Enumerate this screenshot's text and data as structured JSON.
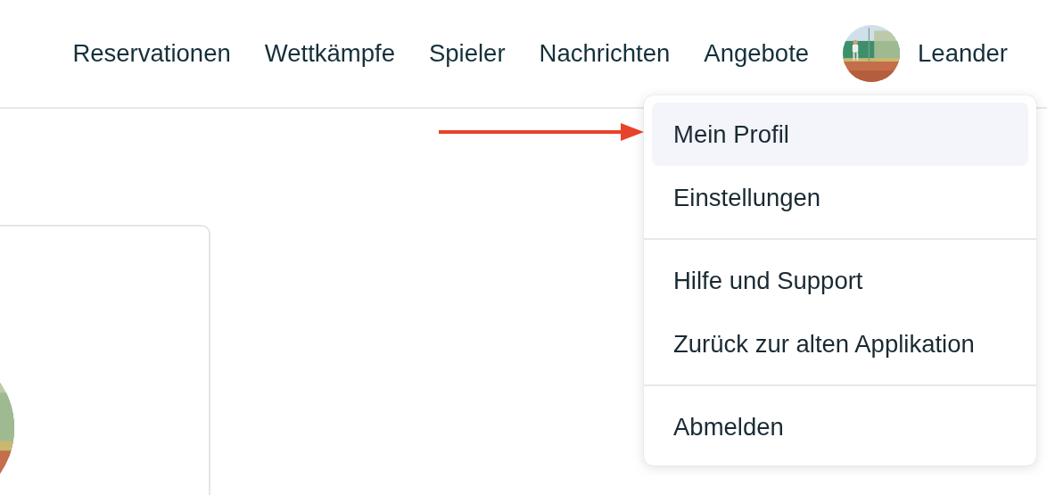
{
  "nav": {
    "items": [
      {
        "label": "Reservationen"
      },
      {
        "label": "Wettkämpfe"
      },
      {
        "label": "Spieler"
      },
      {
        "label": "Nachrichten"
      },
      {
        "label": "Angebote"
      }
    ],
    "user": {
      "name": "Leander"
    }
  },
  "user_menu": {
    "groups": [
      [
        {
          "label": "Mein Profil",
          "selected": true
        },
        {
          "label": "Einstellungen",
          "selected": false
        }
      ],
      [
        {
          "label": "Hilfe und Support",
          "selected": false
        },
        {
          "label": "Zurück zur alten Applikation",
          "selected": false
        }
      ],
      [
        {
          "label": "Abmelden",
          "selected": false
        }
      ]
    ]
  }
}
